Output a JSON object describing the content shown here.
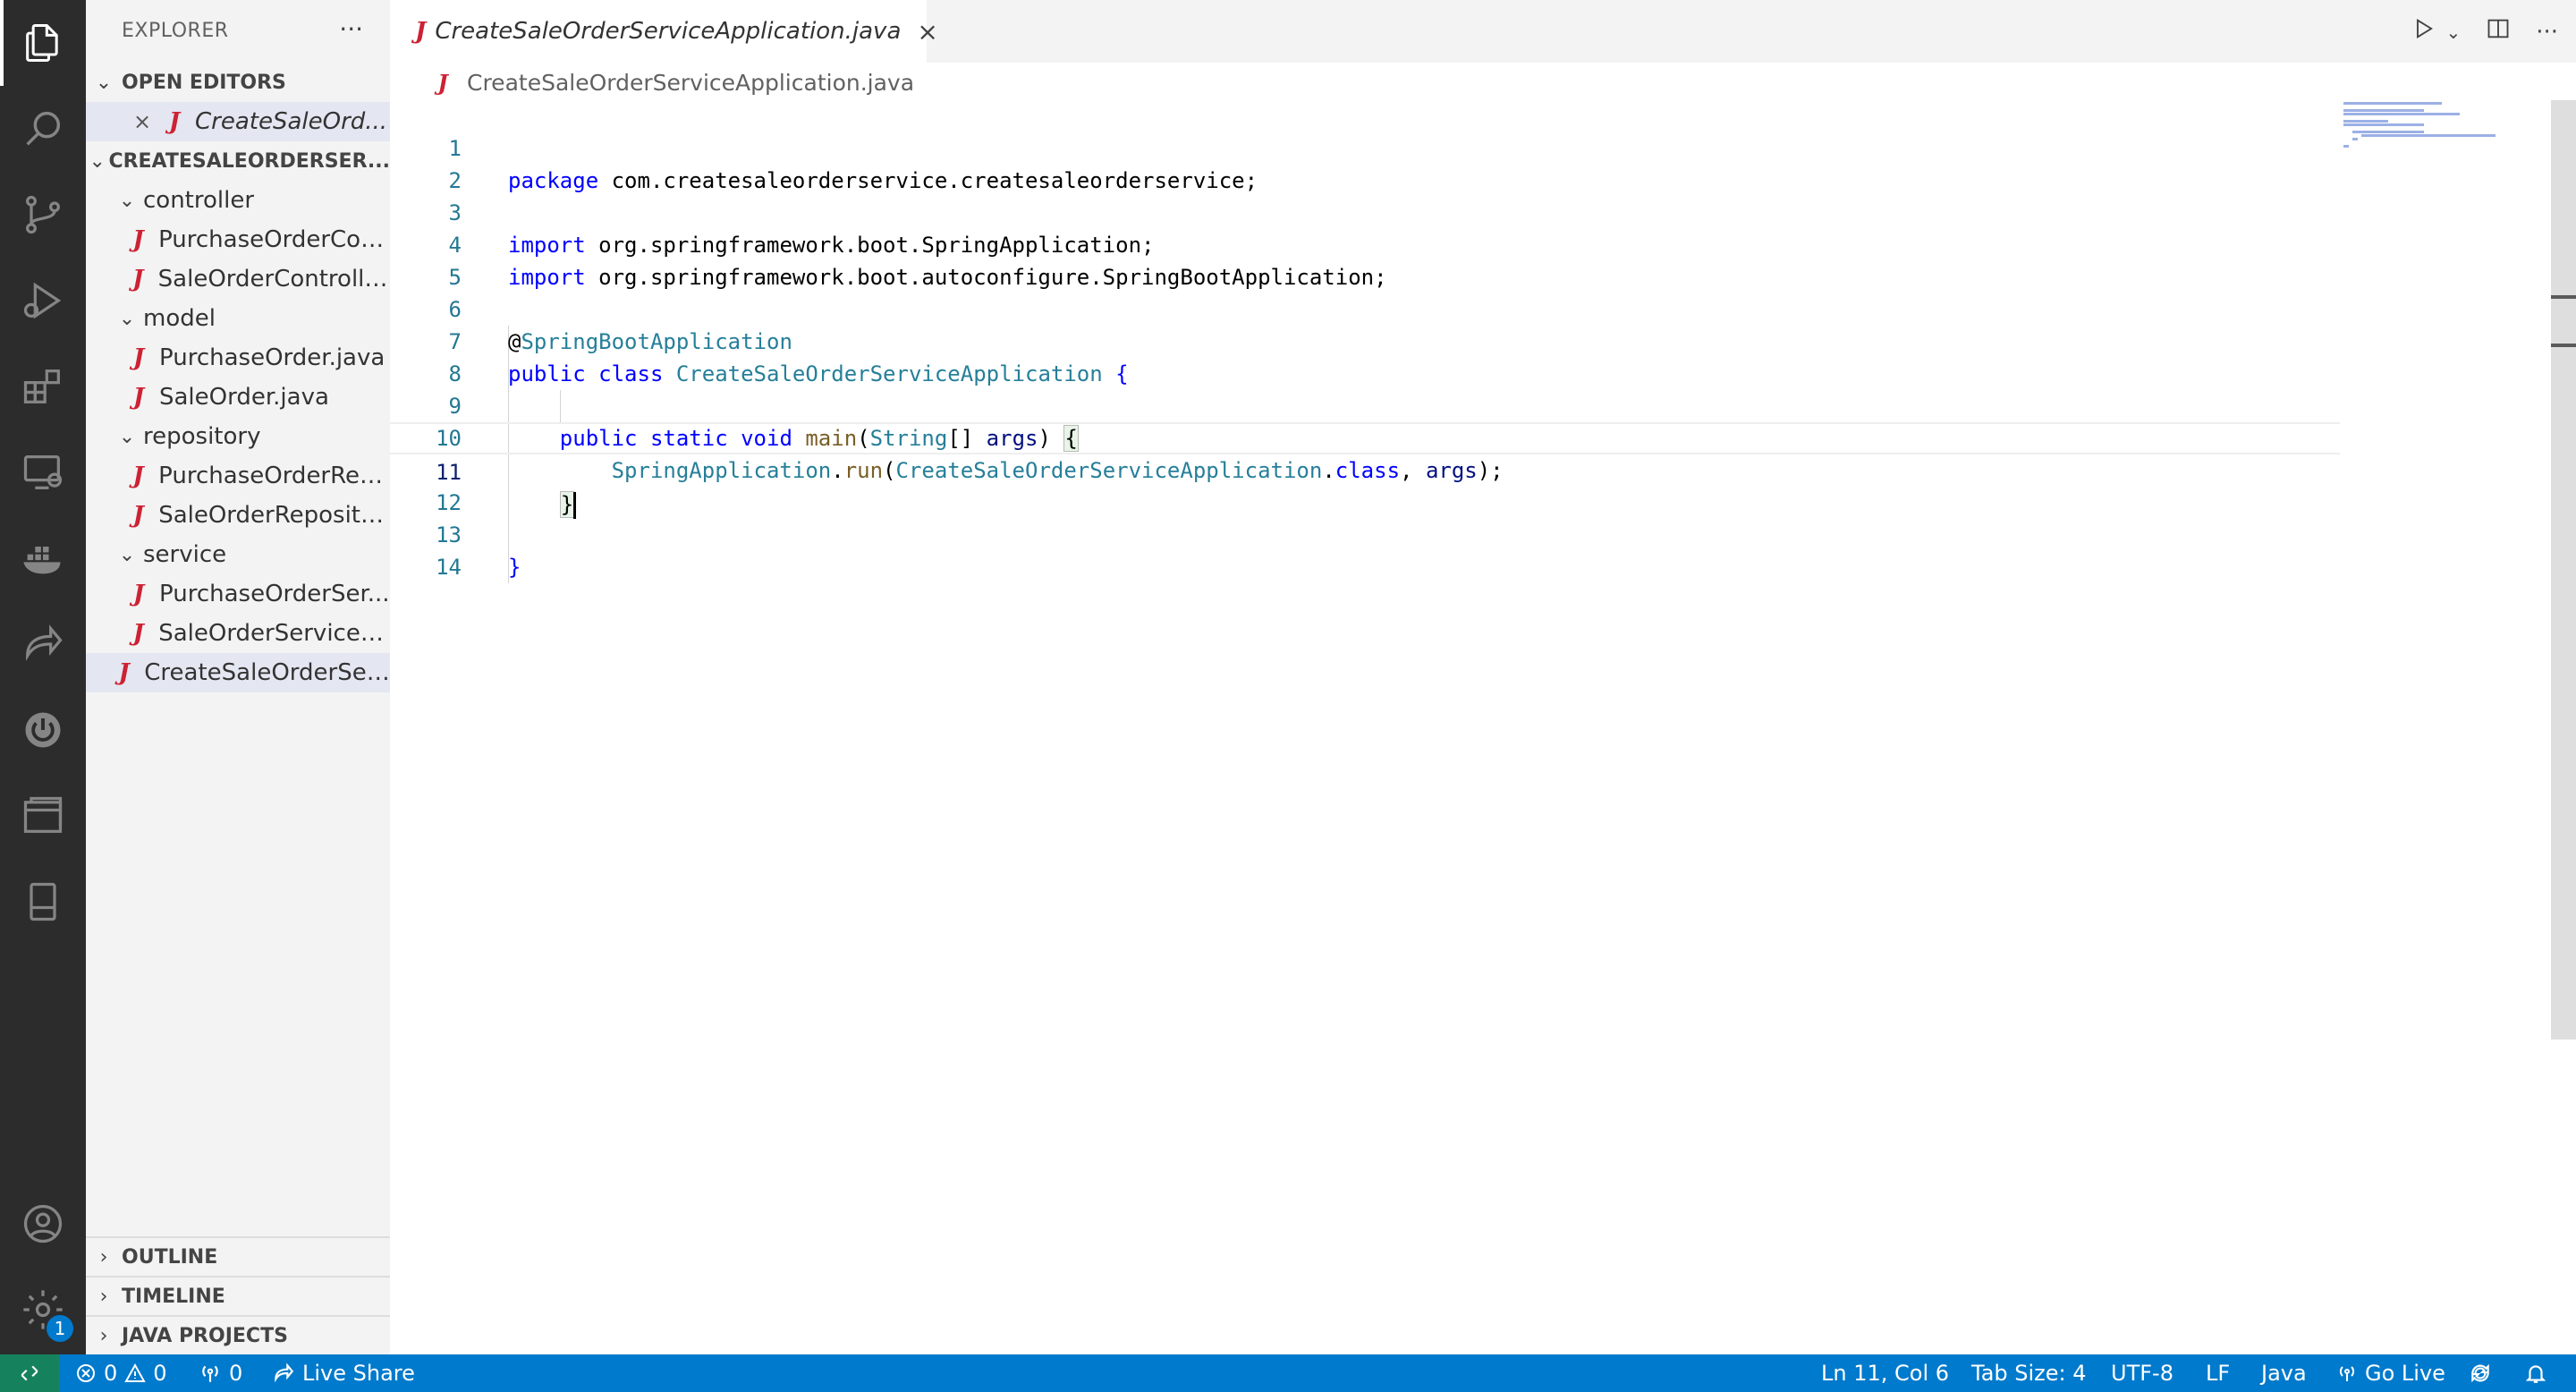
{
  "sidebar": {
    "title": "EXPLORER",
    "more": "···",
    "open_editors": {
      "label": "OPEN EDITORS",
      "items": [
        {
          "close": "×",
          "name": "CreateSaleOrd..."
        }
      ]
    },
    "project": {
      "label": "CREATESALEORDERSER...",
      "folders": [
        {
          "name": "controller",
          "files": [
            "PurchaseOrderCon...",
            "SaleOrderControlle..."
          ]
        },
        {
          "name": "model",
          "files": [
            "PurchaseOrder.java",
            "SaleOrder.java"
          ]
        },
        {
          "name": "repository",
          "files": [
            "PurchaseOrderRep...",
            "SaleOrderReposito..."
          ]
        },
        {
          "name": "service",
          "files": [
            "PurchaseOrderSer...",
            "SaleOrderService.j..."
          ]
        }
      ],
      "root_file": "CreateSaleOrderSer..."
    },
    "bottom_sections": [
      "OUTLINE",
      "TIMELINE",
      "JAVA PROJECTS"
    ]
  },
  "tab": {
    "label": "CreateSaleOrderServiceApplication.java",
    "close": "×"
  },
  "breadcrumb": "CreateSaleOrderServiceApplication.java",
  "java_icon": "J",
  "editor": {
    "line_numbers": [
      "1",
      "2",
      "3",
      "4",
      "5",
      "6",
      "7",
      "8",
      "9",
      "10",
      "11",
      "12",
      "13",
      "14"
    ],
    "current_line": 11,
    "code": {
      "l1_kw": "package",
      "l1_rest": " com.createsaleorderservice.createsaleorderservice;",
      "l3_kw": "import",
      "l3_rest": " org.springframework.boot.SpringApplication;",
      "l4_kw": "import",
      "l4_rest": " org.springframework.boot.autoconfigure.SpringBootApplication;",
      "l6_at": "@",
      "l6_ann": "SpringBootApplication",
      "l7_kw1": "public",
      "l7_kw2": "class",
      "l7_cls": "CreateSaleOrderServiceApplication",
      "l7_brace": "{",
      "l9_kw1": "public",
      "l9_kw2": "static",
      "l9_kw3": "void",
      "l9_fn": "main",
      "l9_p1": "(",
      "l9_ty": "String",
      "l9_p2": "[] ",
      "l9_var": "args",
      "l9_p3": ") ",
      "l9_brace": "{",
      "l10_cls": "SpringApplication",
      "l10_dot": ".",
      "l10_fn": "run",
      "l10_p1": "(",
      "l10_arg": "CreateSaleOrderServiceApplication",
      "l10_dot2": ".",
      "l10_kw": "class",
      "l10_comma": ", ",
      "l10_var": "args",
      "l10_end": ");",
      "l11_brace": "}",
      "l13_brace": "}"
    }
  },
  "statusbar": {
    "remote_icon": "remote-icon",
    "errors": "0",
    "warnings": "0",
    "ports": "0",
    "live_share": "Live Share",
    "position": "Ln 11, Col 6",
    "tab_size": "Tab Size: 4",
    "encoding": "UTF-8",
    "eol": "LF",
    "language": "Java",
    "go_live": "Go Live"
  },
  "activity": {
    "settings_badge": "1"
  },
  "colors": {
    "accent": "#007acc",
    "activity_bar": "#2c2c2c",
    "sidebar": "#f3f3f3",
    "remote": "#16825d",
    "java_icon": "#cc2233"
  }
}
